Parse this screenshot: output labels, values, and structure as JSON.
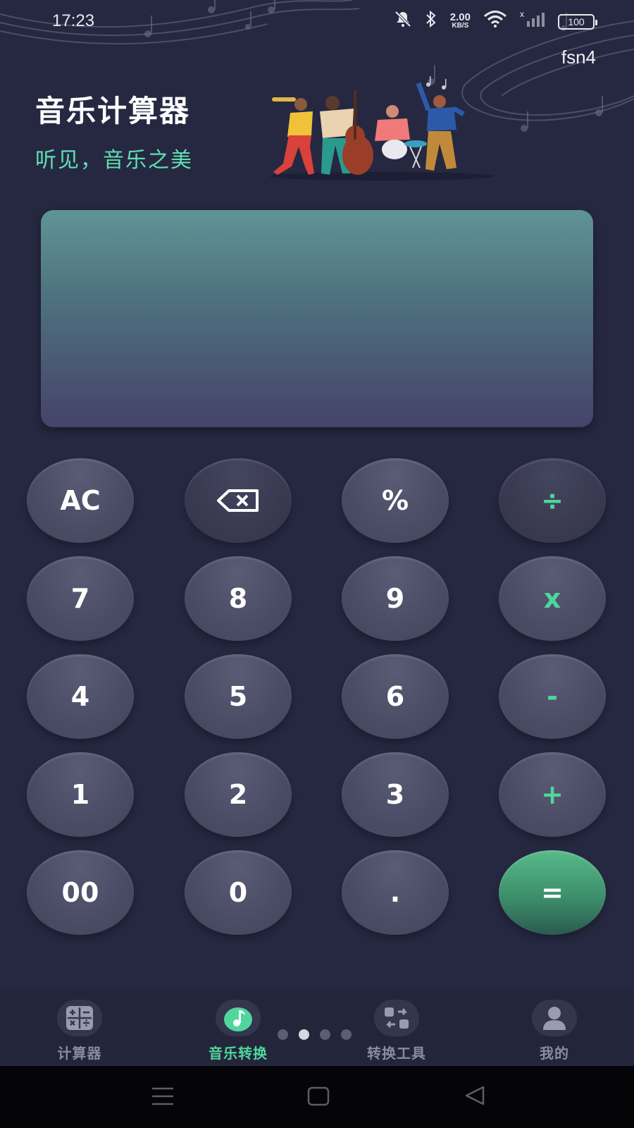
{
  "status_bar": {
    "time": "17:23",
    "net_speed_value": "2.00",
    "net_speed_unit": "KB/S",
    "battery": "100",
    "icons": [
      "mute-icon",
      "bluetooth-icon",
      "wifi-icon",
      "signal-icon"
    ]
  },
  "header": {
    "user_tag": "fsn4",
    "title": "音乐计算器",
    "subtitle": "听见，音乐之美"
  },
  "display": {
    "value": ""
  },
  "keypad": {
    "rows": [
      [
        "AC",
        "backspace",
        "%",
        "÷"
      ],
      [
        "7",
        "8",
        "9",
        "x"
      ],
      [
        "4",
        "5",
        "6",
        "-"
      ],
      [
        "1",
        "2",
        "3",
        "+"
      ],
      [
        "00",
        "0",
        ".",
        "="
      ]
    ],
    "labels": {
      "ac": "AC",
      "percent": "%",
      "divide": "÷",
      "seven": "7",
      "eight": "8",
      "nine": "9",
      "multiply": "x",
      "four": "4",
      "five": "5",
      "six": "6",
      "minus": "-",
      "one": "1",
      "two": "2",
      "three": "3",
      "plus": "+",
      "double_zero": "00",
      "zero": "0",
      "dot": ".",
      "equals": "="
    }
  },
  "pager": {
    "count": 4,
    "active_index": 1
  },
  "tabs": [
    {
      "label": "计算器",
      "icon": "calculator-icon",
      "active": false
    },
    {
      "label": "音乐转换",
      "icon": "music-note-icon",
      "active": true
    },
    {
      "label": "转换工具",
      "icon": "convert-icon",
      "active": false
    },
    {
      "label": "我的",
      "icon": "profile-icon",
      "active": false
    }
  ],
  "system_nav": [
    "menu-icon",
    "home-icon",
    "back-icon"
  ],
  "colors": {
    "background": "#262842",
    "accent": "#4fd69c",
    "key": "#4a4b64",
    "key_dark": "#393a52",
    "tab_bar": "#23253b"
  }
}
